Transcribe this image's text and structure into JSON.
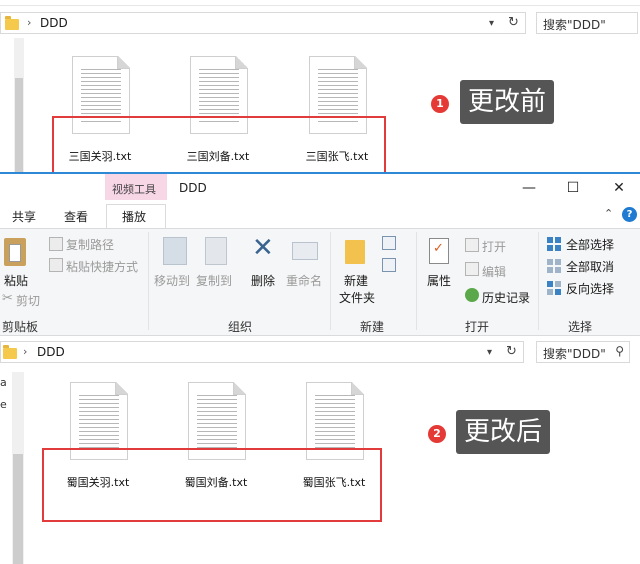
{
  "before": {
    "breadcrumb": "DDD",
    "search_placeholder": "搜索\"DDD\"",
    "files": [
      "三国关羽.txt",
      "三国刘备.txt",
      "三国张飞.txt"
    ],
    "step_number": "1",
    "callout": "更改前"
  },
  "window": {
    "context_tab": "视频工具",
    "title": "DDD",
    "controls": {
      "minimize": "—",
      "maximize": "☐",
      "close": "✕"
    },
    "tabs": [
      "共享",
      "查看",
      "播放"
    ],
    "active_tab": "播放"
  },
  "ribbon": {
    "clipboard": {
      "paste": "粘贴",
      "copy_path": "复制路径",
      "paste_shortcut": "粘贴快捷方式",
      "cut": "剪切",
      "group_label": "剪贴板"
    },
    "organize": {
      "move_to": "移动到",
      "copy_to": "复制到",
      "delete": "删除",
      "rename": "重命名",
      "group_label": "组织"
    },
    "new": {
      "new_folder_line1": "新建",
      "new_folder_line2": "文件夹",
      "group_label": "新建"
    },
    "open": {
      "properties": "属性",
      "open": "打开",
      "edit": "编辑",
      "history": "历史记录",
      "group_label": "打开"
    },
    "select": {
      "select_all": "全部选择",
      "select_none": "全部取消",
      "invert": "反向选择",
      "group_label": "选择"
    }
  },
  "after": {
    "breadcrumb": "DDD",
    "search_placeholder": "搜索\"DDD\"",
    "files": [
      "蜀国关羽.txt",
      "蜀国刘备.txt",
      "蜀国张飞.txt"
    ],
    "step_number": "2",
    "callout": "更改后",
    "left_edge_chars": [
      "a",
      "e"
    ]
  },
  "colors": {
    "highlight_box": "#e23b3b",
    "callout_bg": "#555555",
    "badge": "#e53935",
    "accent": "#2d89d6",
    "context_tab_bg": "#f7d6e6"
  }
}
